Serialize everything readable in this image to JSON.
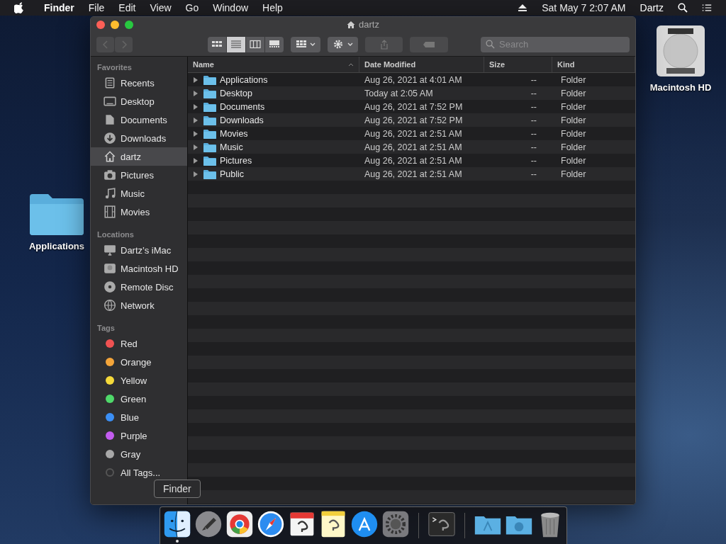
{
  "menubar": {
    "menus": [
      {
        "label": "Finder",
        "kind": "app"
      },
      {
        "label": "File",
        "kind": "menu"
      },
      {
        "label": "Edit",
        "kind": "menu"
      },
      {
        "label": "View",
        "kind": "menu"
      },
      {
        "label": "Go",
        "kind": "menu"
      },
      {
        "label": "Window",
        "kind": "menu"
      },
      {
        "label": "Help",
        "kind": "menu"
      }
    ],
    "date_time": "Sat May 7  2:07 AM",
    "user": "Dartz"
  },
  "desktop_icons": [
    {
      "label": "Applications",
      "kind": "folder"
    },
    {
      "label": "Macintosh HD",
      "kind": "disk"
    }
  ],
  "window": {
    "title": "dartz",
    "view_buttons": [
      {
        "kind": "icons",
        "selected": false
      },
      {
        "kind": "list",
        "selected": true
      },
      {
        "kind": "columns",
        "selected": false
      },
      {
        "kind": "gallery",
        "selected": false
      }
    ],
    "search": {
      "placeholder": "Search"
    }
  },
  "sidebar": {
    "sections": [
      {
        "heading": "Favorites",
        "items": [
          {
            "label": "Recents",
            "kind": "recents",
            "selected": false
          },
          {
            "label": "Desktop",
            "kind": "desktop",
            "selected": false
          },
          {
            "label": "Documents",
            "kind": "documents",
            "selected": false
          },
          {
            "label": "Downloads",
            "kind": "downloads",
            "selected": false
          },
          {
            "label": "dartz",
            "kind": "home",
            "selected": true
          },
          {
            "label": "Pictures",
            "kind": "pictures",
            "selected": false
          },
          {
            "label": "Music",
            "kind": "music",
            "selected": false
          },
          {
            "label": "Movies",
            "kind": "movies",
            "selected": false
          }
        ]
      },
      {
        "heading": "Locations",
        "items": [
          {
            "label": "Dartz’s iMac",
            "kind": "imac",
            "selected": false
          },
          {
            "label": "Macintosh HD",
            "kind": "disk",
            "selected": false
          },
          {
            "label": "Remote Disc",
            "kind": "disc",
            "selected": false
          },
          {
            "label": "Network",
            "kind": "network",
            "selected": false
          }
        ]
      },
      {
        "heading": "Tags",
        "items": [
          {
            "label": "Red",
            "kind": "tag",
            "color": "#f05252",
            "selected": false
          },
          {
            "label": "Orange",
            "kind": "tag",
            "color": "#f4a53a",
            "selected": false
          },
          {
            "label": "Yellow",
            "kind": "tag",
            "color": "#f5d93a",
            "selected": false
          },
          {
            "label": "Green",
            "kind": "tag",
            "color": "#4fd96a",
            "selected": false
          },
          {
            "label": "Blue",
            "kind": "tag",
            "color": "#3b8ff5",
            "selected": false
          },
          {
            "label": "Purple",
            "kind": "tag",
            "color": "#c35cf0",
            "selected": false
          },
          {
            "label": "Gray",
            "kind": "tag",
            "color": "#a8a8a8",
            "selected": false
          },
          {
            "label": "All Tags...",
            "kind": "alltags",
            "selected": false
          }
        ]
      }
    ]
  },
  "table": {
    "columns": [
      {
        "label": "Name",
        "sorted": true
      },
      {
        "label": "Date Modified",
        "sorted": false
      },
      {
        "label": "Size",
        "sorted": false
      },
      {
        "label": "Kind",
        "sorted": false
      }
    ],
    "rows": [
      {
        "name": "Applications",
        "date": "Aug 26, 2021 at 4:01 AM",
        "size": "--",
        "kind": "Folder"
      },
      {
        "name": "Desktop",
        "date": "Today at 2:05 AM",
        "size": "--",
        "kind": "Folder"
      },
      {
        "name": "Documents",
        "date": "Aug 26, 2021 at 7:52 PM",
        "size": "--",
        "kind": "Folder"
      },
      {
        "name": "Downloads",
        "date": "Aug 26, 2021 at 7:52 PM",
        "size": "--",
        "kind": "Folder"
      },
      {
        "name": "Movies",
        "date": "Aug 26, 2021 at 2:51 AM",
        "size": "--",
        "kind": "Folder"
      },
      {
        "name": "Music",
        "date": "Aug 26, 2021 at 2:51 AM",
        "size": "--",
        "kind": "Folder"
      },
      {
        "name": "Pictures",
        "date": "Aug 26, 2021 at 2:51 AM",
        "size": "--",
        "kind": "Folder"
      },
      {
        "name": "Public",
        "date": "Aug 26, 2021 at 2:51 AM",
        "size": "--",
        "kind": "Folder"
      }
    ]
  },
  "dock": {
    "tooltip": "Finder",
    "items": [
      {
        "kind": "finder",
        "running": true
      },
      {
        "kind": "launchpad",
        "running": false
      },
      {
        "kind": "chrome",
        "running": false
      },
      {
        "kind": "safari",
        "running": false
      },
      {
        "kind": "calendar",
        "running": false
      },
      {
        "kind": "notes",
        "running": false
      },
      {
        "kind": "appstore",
        "running": false
      },
      {
        "kind": "preferences",
        "running": false
      },
      {
        "kind": "separator"
      },
      {
        "kind": "terminal",
        "running": false
      },
      {
        "kind": "separator"
      },
      {
        "kind": "apps-folder",
        "running": false
      },
      {
        "kind": "downloads-folder",
        "running": false
      },
      {
        "kind": "trash",
        "running": false
      }
    ]
  }
}
